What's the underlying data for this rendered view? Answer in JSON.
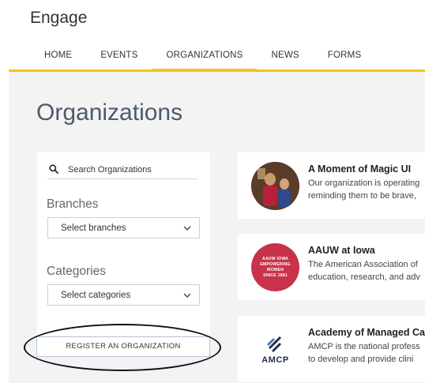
{
  "app": {
    "title": "Engage"
  },
  "nav": {
    "items": [
      {
        "label": "HOME",
        "active": false
      },
      {
        "label": "EVENTS",
        "active": false
      },
      {
        "label": "ORGANIZATIONS",
        "active": true
      },
      {
        "label": "NEWS",
        "active": false
      },
      {
        "label": "FORMS",
        "active": false
      }
    ]
  },
  "colors": {
    "accent": "#f6c218",
    "title": "#4d5a6b",
    "background": "#f3f3f3"
  },
  "page": {
    "title": "Organizations"
  },
  "filters": {
    "search_placeholder": "Search Organizations",
    "branches_label": "Branches",
    "branches_value": "Select branches",
    "categories_label": "Categories",
    "categories_value": "Select categories"
  },
  "register_button": {
    "label": "REGISTER AN ORGANIZATION"
  },
  "organizations": [
    {
      "name": "A Moment of Magic UI",
      "desc_line1": "Our organization is operating",
      "desc_line2": "reminding them to be brave,",
      "logo": "photo-logo"
    },
    {
      "name": "AAUW at Iowa",
      "desc_line1": "The American Association of",
      "desc_line2": "education, research, and adv",
      "logo": "aauw-logo",
      "logo_text": [
        "AAUW IOWA",
        "EMPOWERING",
        "WOMEN",
        "SINCE 1881"
      ]
    },
    {
      "name": "Academy of Managed Ca",
      "desc_line1": "AMCP is the national profess",
      "desc_line2": "to develop and provide clini",
      "logo": "amcp-logo",
      "logo_text": "AMCP"
    }
  ]
}
